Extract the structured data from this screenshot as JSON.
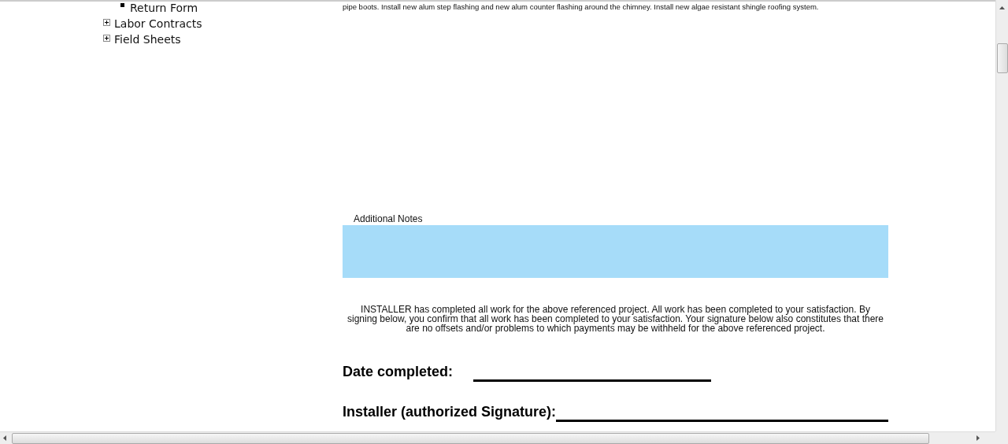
{
  "sidebar": {
    "items": [
      {
        "label": "Return Form",
        "kind": "leaf"
      },
      {
        "label": "Labor Contracts",
        "kind": "folder",
        "expanded": false
      },
      {
        "label": "Field Sheets",
        "kind": "folder",
        "expanded": false
      }
    ]
  },
  "scope_text": "pipe boots. Install new alum step flashing and new alum counter flashing around the chimney. Install new algae resistant shingle roofing system.",
  "additional_notes": {
    "label": "Additional Notes"
  },
  "statement": "INSTALLER has completed all work for the above referenced project. All work has been completed to your satisfaction. By signing below, you confirm that all work has been completed to your satisfaction. Your signature below also constitutes that there are no offsets and/or problems to which payments may be withheld for the above referenced project.",
  "date_completed": {
    "label": "Date completed:"
  },
  "installer_signature": {
    "label": "Installer (authorized Signature):"
  }
}
